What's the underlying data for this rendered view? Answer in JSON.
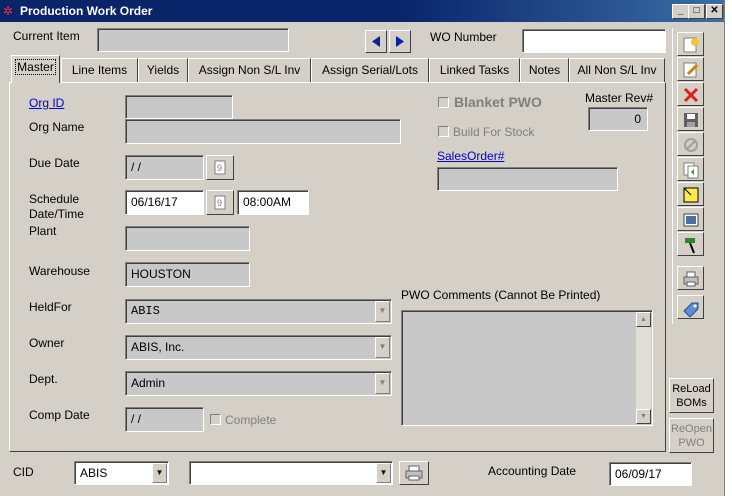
{
  "window": {
    "title": "Production Work Order"
  },
  "header": {
    "current_item_label": "Current Item",
    "current_item_value": "",
    "wo_number_label": "WO Number",
    "wo_number_value": ""
  },
  "tabs": [
    "Master",
    "Line Items",
    "Yields",
    "Assign  Non S/L Inv",
    "Assign Serial/Lots",
    "Linked Tasks",
    "Notes",
    "All Non S/L Inv"
  ],
  "master": {
    "org_id_label": "Org ID",
    "org_id_value": "",
    "org_name_label": "Org Name",
    "org_name_value": "",
    "due_date_label": "Due Date",
    "due_date_value": "/ /",
    "schedule_label_1": "Schedule",
    "schedule_label_2": "Date/Time",
    "schedule_date": "06/16/17",
    "schedule_time": "08:00AM",
    "plant_label": "Plant",
    "plant_value": "",
    "warehouse_label": "Warehouse",
    "warehouse_value": "HOUSTON",
    "heldfor_label": "HeldFor",
    "heldfor_value": "ABIS",
    "owner_label": "Owner",
    "owner_value": "ABIS, Inc.",
    "dept_label": "Dept.",
    "dept_value": "Admin",
    "comp_date_label": "Comp Date",
    "comp_date_value": "/ /",
    "complete_label": "Complete",
    "blanket_pwo_label": "Blanket PWO",
    "build_for_stock_label": "Build For Stock",
    "master_rev_label": "Master Rev#",
    "master_rev_value": "0",
    "sales_order_label": "SalesOrder#",
    "sales_order_value": "",
    "pwo_comments_label": "PWO Comments  (Cannot Be Printed)",
    "pwo_comments_value": ""
  },
  "side_buttons": {
    "reload_1": "ReLoad",
    "reload_2": "BOMs",
    "reopen_1": "ReOpen",
    "reopen_2": "PWO"
  },
  "footer": {
    "cid_label": "CID",
    "cid_value": "ABIS",
    "cid2_value": "",
    "accounting_date_label": "Accounting Date",
    "accounting_date_value": "06/09/17"
  },
  "toolbar_icons": [
    "new-icon",
    "edit-icon",
    "delete-icon",
    "save-icon",
    "cancel-icon",
    "copy-icon",
    "note-icon",
    "image-icon",
    "hammer-icon",
    "print-icon",
    "tag-icon"
  ],
  "colors": {
    "title_bar": "#0a246a",
    "window_bg": "#d4d0c8",
    "field_disabled": "#c8c8c8",
    "link": "#0000cc"
  }
}
